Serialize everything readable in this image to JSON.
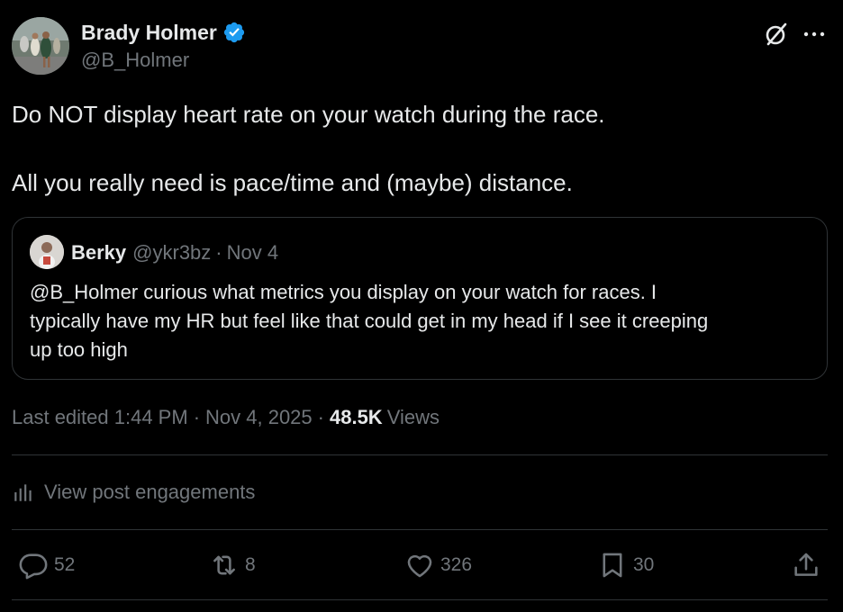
{
  "author": {
    "name": "Brady Holmer",
    "handle": "@B_Holmer",
    "verified": true,
    "verified_color": "#1d9bf0"
  },
  "header_icons": [
    "grok-icon",
    "more-icon"
  ],
  "post": {
    "lines": [
      "Do NOT display heart rate on your watch during the race.",
      "All you really need is pace/time and (maybe) distance."
    ]
  },
  "quoted": {
    "name": "Berky",
    "handle": "@ykr3bz",
    "separator": "·",
    "date": "Nov 4",
    "text_lines": [
      "@B_Holmer curious what metrics you display on your watch for races. I",
      "typically have my HR but feel like that could get in my head if I see it creeping",
      "up too high"
    ]
  },
  "meta": {
    "edited": "Last edited 1:44 PM",
    "separator": "·",
    "date": "Nov 4, 2025",
    "views_count": "48.5K",
    "views_label": "Views"
  },
  "engagements_label": "View post engagements",
  "actions": {
    "replies": "52",
    "reposts": "8",
    "likes": "326",
    "bookmarks": "30"
  },
  "colors": {
    "background": "#000000",
    "text": "#e7e9ea",
    "muted": "#71767b",
    "border": "#2f3336"
  }
}
